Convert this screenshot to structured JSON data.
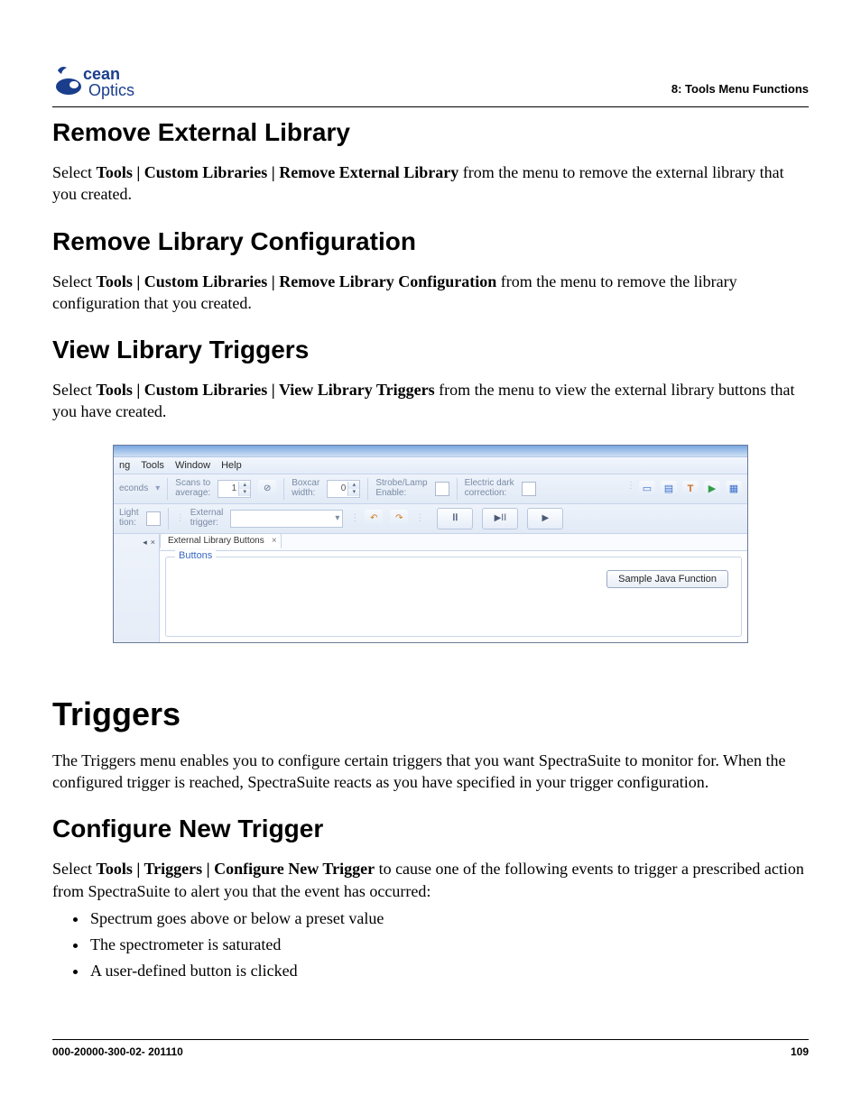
{
  "header": {
    "brand_top": "cean",
    "brand_bottom": "Optics",
    "section_label": "8: Tools Menu Functions"
  },
  "s1": {
    "title": "Remove External Library",
    "p_pre": "Select ",
    "p_bold": "Tools | Custom Libraries | Remove External Library",
    "p_post": " from the menu to remove the external library that you created."
  },
  "s2": {
    "title": "Remove Library Configuration",
    "p_pre": "Select ",
    "p_bold": "Tools | Custom Libraries | Remove Library Configuration",
    "p_post": " from the menu to remove the library configuration that you created."
  },
  "s3": {
    "title": "View Library Triggers",
    "p_pre": "Select ",
    "p_bold": "Tools | Custom Libraries | View Library Triggers",
    "p_post": " from the menu to view the external library buttons that you have created."
  },
  "screenshot": {
    "menus": {
      "ng": "ng",
      "tools": "Tools",
      "window": "Window",
      "help": "Help"
    },
    "tb1": {
      "econds": "econds",
      "scans": "Scans to\naverage:",
      "scans_val": "1",
      "boxcar": "Boxcar\nwidth:",
      "boxcar_val": "0",
      "strobe": "Strobe/Lamp\nEnable:",
      "edc": "Electric dark\ncorrection:"
    },
    "tb2": {
      "light": "Light\ntion:",
      "ext_trigger": "External\ntrigger:"
    },
    "side": {
      "pin": "◂",
      "close": "×"
    },
    "tab": {
      "label": "External Library Buttons",
      "close": "×"
    },
    "group_legend": "Buttons",
    "sample_btn": "Sample Java Function"
  },
  "s4": {
    "title": "Triggers",
    "para": "The Triggers menu enables you to configure certain triggers that you want SpectraSuite to monitor for. When the configured trigger is reached, SpectraSuite reacts as you have specified in your trigger configuration."
  },
  "s5": {
    "title": "Configure New Trigger",
    "p_pre": "Select ",
    "p_bold": "Tools | Triggers | Configure New Trigger",
    "p_post": " to cause one of the following events to trigger a prescribed action from SpectraSuite to alert you that the event has occurred:",
    "bullets": [
      "Spectrum goes above or below a preset value",
      "The spectrometer is saturated",
      "A user-defined button is clicked"
    ]
  },
  "footer": {
    "left": "000-20000-300-02- 201110",
    "right": "109"
  }
}
